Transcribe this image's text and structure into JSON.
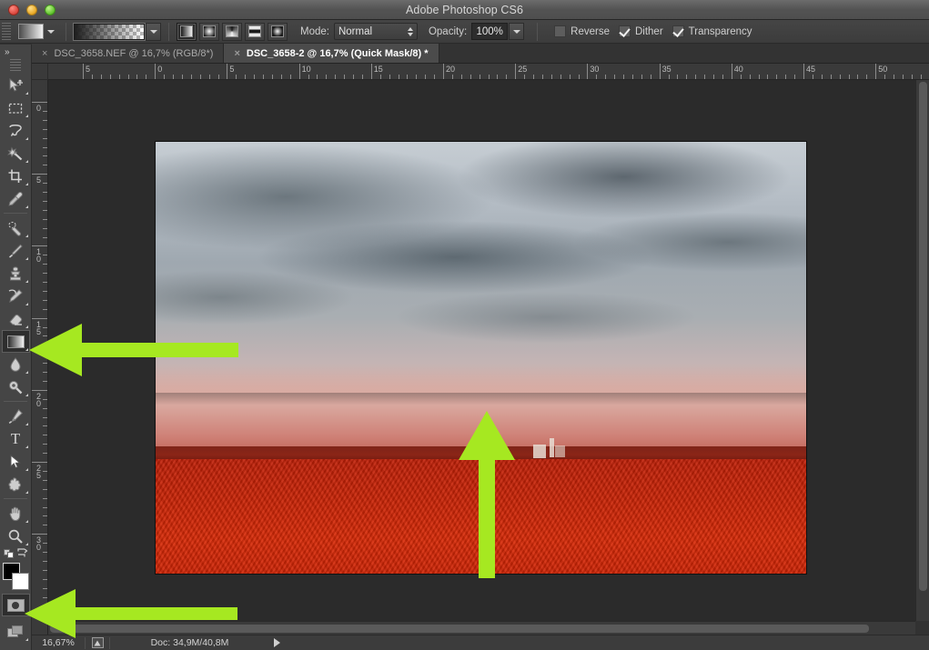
{
  "window": {
    "title": "Adobe Photoshop CS6",
    "traffic_lights": [
      "close",
      "minimize",
      "zoom"
    ]
  },
  "options_bar": {
    "tool_preset_icon": "gradient-thumbnail",
    "gradient_swatch": "black-to-transparent",
    "gradient_types": [
      {
        "name": "linear-gradient",
        "selected": true
      },
      {
        "name": "radial-gradient",
        "selected": false
      },
      {
        "name": "angle-gradient",
        "selected": false
      },
      {
        "name": "reflected-gradient",
        "selected": false
      },
      {
        "name": "diamond-gradient",
        "selected": false
      }
    ],
    "mode_label": "Mode:",
    "mode_value": "Normal",
    "opacity_label": "Opacity:",
    "opacity_value": "100%",
    "checkboxes": [
      {
        "label": "Reverse",
        "checked": false
      },
      {
        "label": "Dither",
        "checked": true
      },
      {
        "label": "Transparency",
        "checked": true
      }
    ]
  },
  "tabs": [
    {
      "title": "DSC_3658.NEF @ 16,7% (RGB/8*)",
      "active": false,
      "close": "×"
    },
    {
      "title": "DSC_3658-2 @ 16,7% (Quick Mask/8) *",
      "active": true,
      "close": "×"
    }
  ],
  "toolbar": {
    "expander": "»",
    "tools": [
      {
        "name": "move-tool",
        "selected": false
      },
      {
        "name": "rectangular-marquee-tool",
        "selected": false
      },
      {
        "name": "lasso-tool",
        "selected": false
      },
      {
        "name": "magic-wand-tool",
        "selected": false
      },
      {
        "name": "crop-tool",
        "selected": false
      },
      {
        "name": "eyedropper-tool",
        "selected": false
      },
      {
        "name": "spot-healing-brush-tool",
        "selected": false
      },
      {
        "name": "brush-tool",
        "selected": false
      },
      {
        "name": "clone-stamp-tool",
        "selected": false
      },
      {
        "name": "history-brush-tool",
        "selected": false
      },
      {
        "name": "eraser-tool",
        "selected": false
      },
      {
        "name": "gradient-tool",
        "selected": true
      },
      {
        "name": "blur-tool",
        "selected": false
      },
      {
        "name": "dodge-tool",
        "selected": false
      },
      {
        "name": "pen-tool",
        "selected": false
      },
      {
        "name": "type-tool",
        "selected": false
      },
      {
        "name": "path-selection-tool",
        "selected": false
      },
      {
        "name": "custom-shape-tool",
        "selected": false
      },
      {
        "name": "hand-tool",
        "selected": false
      },
      {
        "name": "zoom-tool",
        "selected": false
      }
    ],
    "type_tool_glyph": "T",
    "foreground_color": "#000000",
    "background_color": "#ffffff",
    "quick_mask_selected": true,
    "screen_mode": "standard-screen-mode"
  },
  "rulers": {
    "unit_hint": "cm",
    "horizontal_ticks": [
      "5",
      "0",
      "5",
      "10",
      "15",
      "20",
      "25",
      "30",
      "35",
      "40",
      "45",
      "50"
    ],
    "vertical_ticks": [
      "0",
      "5",
      "10",
      "15",
      "20",
      "25",
      "30"
    ]
  },
  "document": {
    "zoom": "16,67%",
    "doc_size": "Doc: 34,9M/40,8M",
    "image_description": "storm-clouds-over-red-quick-mask-field"
  },
  "annotations": [
    {
      "name": "arrow-to-gradient-tool",
      "direction": "left",
      "color": "#a6e821"
    },
    {
      "name": "arrow-to-quick-mask-button",
      "direction": "left",
      "color": "#a6e821"
    },
    {
      "name": "arrow-to-gradient-drag-direction",
      "direction": "up",
      "color": "#a6e821"
    }
  ],
  "colors": {
    "annotation_green": "#a6e821",
    "chrome": "#454545",
    "canvas_bg": "#2b2b2b"
  }
}
